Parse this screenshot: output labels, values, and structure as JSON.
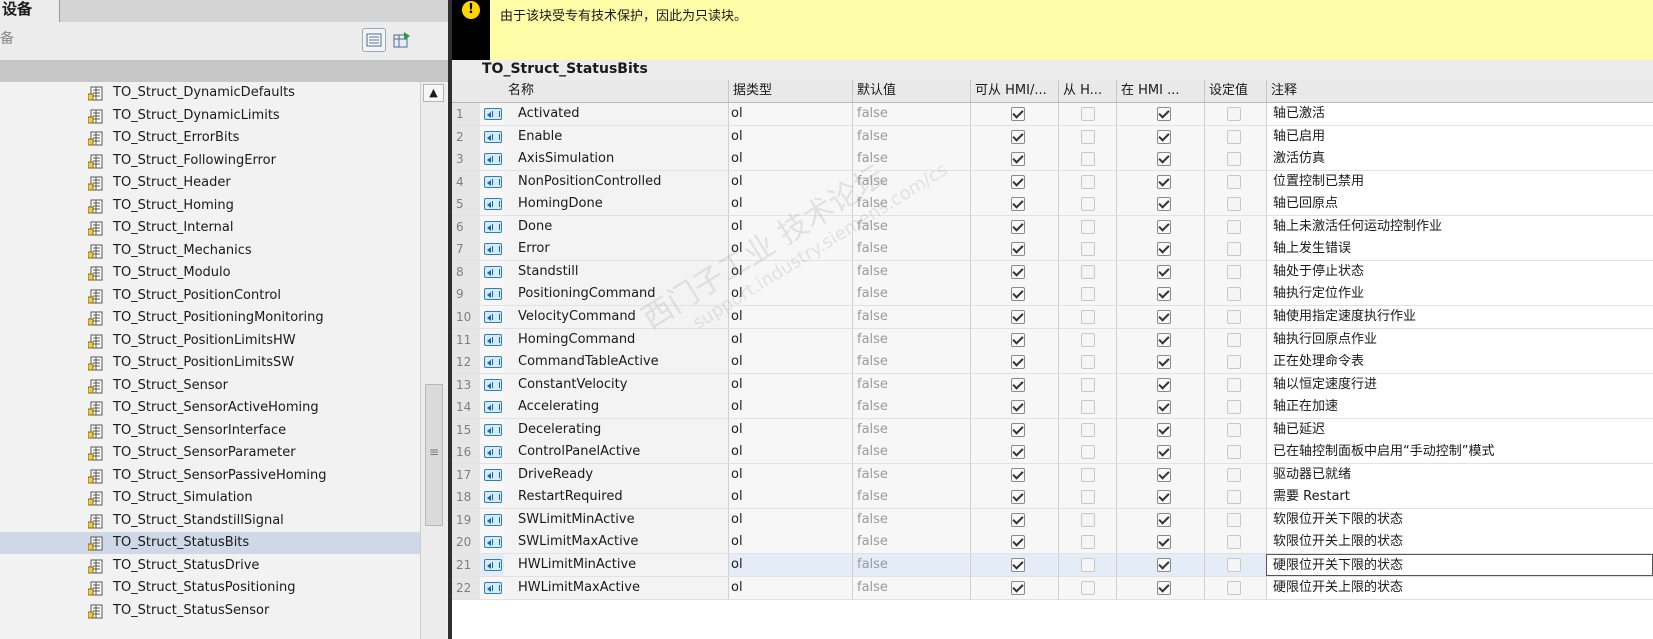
{
  "left": {
    "tab_label": "设备",
    "tool_fragment": "备",
    "tree_items": [
      "TO_Struct_DynamicDefaults",
      "TO_Struct_DynamicLimits",
      "TO_Struct_ErrorBits",
      "TO_Struct_FollowingError",
      "TO_Struct_Header",
      "TO_Struct_Homing",
      "TO_Struct_Internal",
      "TO_Struct_Mechanics",
      "TO_Struct_Modulo",
      "TO_Struct_PositionControl",
      "TO_Struct_PositioningMonitoring",
      "TO_Struct_PositionLimitsHW",
      "TO_Struct_PositionLimitsSW",
      "TO_Struct_Sensor",
      "TO_Struct_SensorActiveHoming",
      "TO_Struct_SensorInterface",
      "TO_Struct_SensorParameter",
      "TO_Struct_SensorPassiveHoming",
      "TO_Struct_Simulation",
      "TO_Struct_StandstillSignal",
      "TO_Struct_StatusBits",
      "TO_Struct_StatusDrive",
      "TO_Struct_StatusPositioning",
      "TO_Struct_StatusSensor"
    ],
    "selected_item": "TO_Struct_StatusBits"
  },
  "right": {
    "message": "由于该块受专有技术保护，因此为只读块。",
    "block_title": "TO_Struct_StatusBits",
    "columns": {
      "name": "名称",
      "type": "据类型",
      "default": "默认值",
      "hmi_access": "可从 HMI/...",
      "from_h": "从 H...",
      "in_hmi": "在 HMI ...",
      "setpoint": "设定值",
      "comment": "注释"
    },
    "rows": [
      {
        "n": "1",
        "name": "Activated",
        "type": "ol",
        "def": "false",
        "comment": "轴已激活"
      },
      {
        "n": "2",
        "name": "Enable",
        "type": "ol",
        "def": "false",
        "comment": "轴已启用"
      },
      {
        "n": "3",
        "name": "AxisSimulation",
        "type": "ol",
        "def": "false",
        "comment": "激活仿真"
      },
      {
        "n": "4",
        "name": "NonPositionControlled",
        "type": "ol",
        "def": "false",
        "comment": "位置控制已禁用"
      },
      {
        "n": "5",
        "name": "HomingDone",
        "type": "ol",
        "def": "false",
        "comment": "轴已回原点"
      },
      {
        "n": "6",
        "name": "Done",
        "type": "ol",
        "def": "false",
        "comment": "轴上未激活任何运动控制作业"
      },
      {
        "n": "7",
        "name": "Error",
        "type": "ol",
        "def": "false",
        "comment": "轴上发生错误"
      },
      {
        "n": "8",
        "name": "Standstill",
        "type": "ol",
        "def": "false",
        "comment": "轴处于停止状态"
      },
      {
        "n": "9",
        "name": "PositioningCommand",
        "type": "ol",
        "def": "false",
        "comment": "轴执行定位作业"
      },
      {
        "n": "10",
        "name": "VelocityCommand",
        "type": "ol",
        "def": "false",
        "comment": "轴使用指定速度执行作业"
      },
      {
        "n": "11",
        "name": "HomingCommand",
        "type": "ol",
        "def": "false",
        "comment": "轴执行回原点作业"
      },
      {
        "n": "12",
        "name": "CommandTableActive",
        "type": "ol",
        "def": "false",
        "comment": "正在处理命令表"
      },
      {
        "n": "13",
        "name": "ConstantVelocity",
        "type": "ol",
        "def": "false",
        "comment": "轴以恒定速度行进"
      },
      {
        "n": "14",
        "name": "Accelerating",
        "type": "ol",
        "def": "false",
        "comment": "轴正在加速"
      },
      {
        "n": "15",
        "name": "Decelerating",
        "type": "ol",
        "def": "false",
        "comment": "轴已延迟"
      },
      {
        "n": "16",
        "name": "ControlPanelActive",
        "type": "ol",
        "def": "false",
        "comment": "已在轴控制面板中启用“手动控制”模式"
      },
      {
        "n": "17",
        "name": "DriveReady",
        "type": "ol",
        "def": "false",
        "comment": "驱动器已就绪"
      },
      {
        "n": "18",
        "name": "RestartRequired",
        "type": "ol",
        "def": "false",
        "comment": "需要 Restart"
      },
      {
        "n": "19",
        "name": "SWLimitMinActive",
        "type": "ol",
        "def": "false",
        "comment": "软限位开关下限的状态"
      },
      {
        "n": "20",
        "name": "SWLimitMaxActive",
        "type": "ol",
        "def": "false",
        "comment": "软限位开关上限的状态"
      },
      {
        "n": "21",
        "name": "HWLimitMinActive",
        "type": "ol",
        "def": "false",
        "comment": "硬限位开关下限的状态"
      },
      {
        "n": "22",
        "name": "HWLimitMaxActive",
        "type": "ol",
        "def": "false",
        "comment": "硬限位开关上限的状态"
      }
    ],
    "highlighted_row": "21",
    "checkbox_state": {
      "hmi_access": true,
      "from_h": false,
      "in_hmi": true,
      "setpoint": false
    }
  },
  "watermark": {
    "line1": "西门子工业 技术论坛",
    "line2": "support.industry.siemens.com/cs"
  },
  "icons": {
    "tree_item": "data-block-icon",
    "row": "static-var-icon",
    "warning": "warning-icon"
  }
}
